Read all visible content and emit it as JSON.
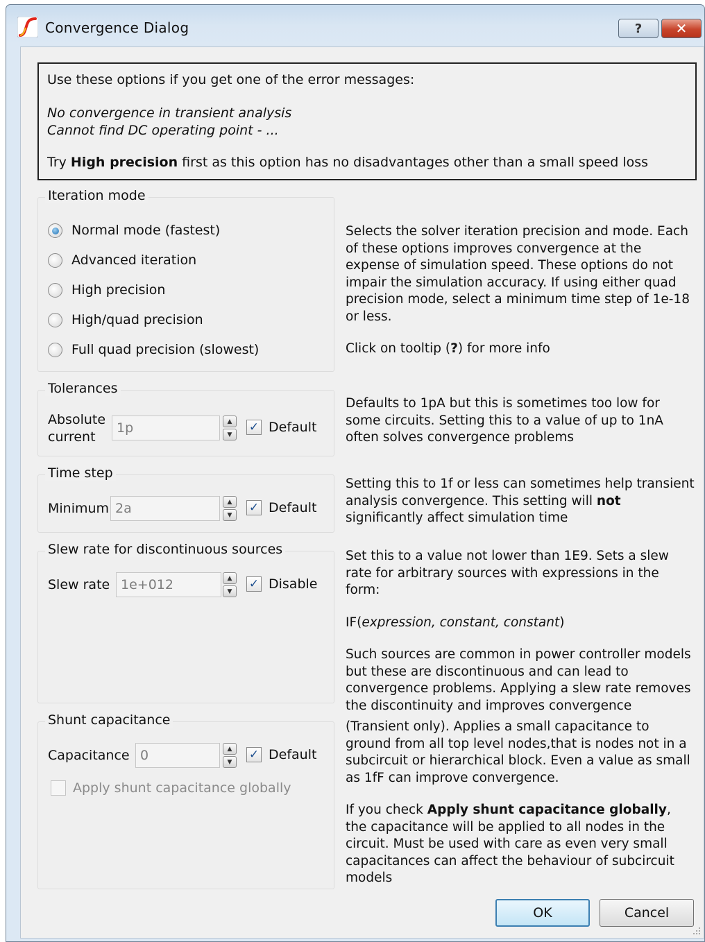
{
  "window": {
    "title": "Convergence Dialog",
    "help_button": "?",
    "close_button": "✕",
    "icon": "app-logo-icon"
  },
  "info": {
    "line1": "Use these options if you get one of the error messages:",
    "error1": "No convergence in transient analysis",
    "error2": "Cannot find DC operating point - ...",
    "tip_prefix": "Try ",
    "tip_bold": "High precision",
    "tip_suffix": " first as this option has no disadvantages other than a small speed loss"
  },
  "iteration_mode": {
    "title": "Iteration mode",
    "options": [
      {
        "label": "Normal mode (fastest)",
        "selected": true
      },
      {
        "label": "Advanced iteration",
        "selected": false
      },
      {
        "label": "High precision",
        "selected": false
      },
      {
        "label": "High/quad precision",
        "selected": false
      },
      {
        "label": "Full quad precision (slowest)",
        "selected": false
      }
    ],
    "desc1": "Selects the solver iteration precision and mode. Each of these options improves convergence at the expense of simulation speed. These options do not impair the simulation accuracy. If using either quad precision mode, select a minimum time step of 1e-18 or less.",
    "desc2_prefix": "Click on tooltip (",
    "desc2_bold": "?",
    "desc2_suffix": ") for more info"
  },
  "tolerances": {
    "title": "Tolerances",
    "label_line1": "Absolute",
    "label_line2": "current",
    "value": "1p",
    "checkbox_label": "Default",
    "checked": true,
    "desc": "Defaults to 1pA but this is sometimes too low for some circuits. Setting this to a value of up to 1nA often solves convergence problems"
  },
  "time_step": {
    "title": "Time step",
    "label": "Minimum",
    "value": "2a",
    "checkbox_label": "Default",
    "checked": true,
    "desc_prefix": "Setting this to 1f or less can sometimes help transient analysis convergence. This setting will ",
    "desc_bold": "not",
    "desc_suffix": " significantly affect simulation time"
  },
  "slew_rate": {
    "title": "Slew rate for discontinuous sources",
    "label": "Slew rate",
    "value": "1e+012",
    "checkbox_label": "Disable",
    "checked": true,
    "desc1": "Set this to a value not lower than 1E9. Sets a slew rate for arbitrary sources with expressions in the form:",
    "desc2_prefix": "IF(",
    "desc2_italic": "expression, constant, constant",
    "desc2_suffix": ")",
    "desc3": "Such sources are common in power controller models but these are discontinuous and can lead to convergence problems. Applying a slew rate removes the discontinuity and improves convergence"
  },
  "shunt": {
    "title": "Shunt capacitance",
    "label": "Capacitance",
    "value": "0",
    "checkbox_label": "Default",
    "checked": true,
    "global_label": "Apply shunt capacitance globally",
    "global_checked": false,
    "desc1": "(Transient only). Applies a small capacitance to ground from all top level nodes,that is nodes not in a subcircuit or hierarchical block. Even a value as small as 1fF can improve convergence.",
    "desc2_prefix": "If you check ",
    "desc2_bold": "Apply shunt capacitance globally",
    "desc2_suffix": ", the capacitance will be applied to all nodes in the circuit. Must be used with care as even very small capacitances can affect the behaviour of subcircuit models"
  },
  "buttons": {
    "ok": "OK",
    "cancel": "Cancel"
  }
}
